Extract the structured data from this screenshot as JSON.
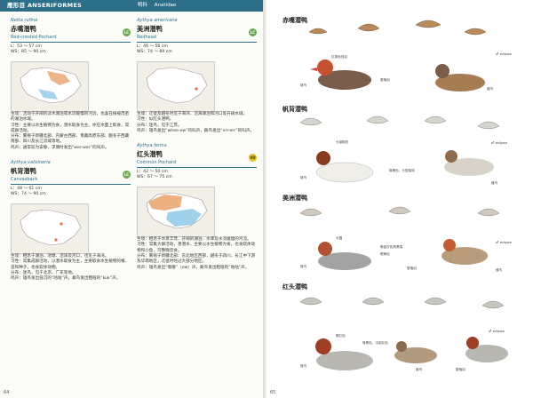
{
  "header": {
    "order": "雁形目 ANSERIFORMES",
    "family_cn": "鸭科",
    "family_en": "Anatidae"
  },
  "species": [
    {
      "sci": "Netta rufina",
      "cn": "赤嘴潜鸭",
      "en": "Red-crested Pochard",
      "status": "LC",
      "L": "L：53 ～ 57 cm",
      "WS": "WS：85 ～ 90 cm",
      "habitat": "生境：活动于开阔的淡水湖泊或水流缓慢的河流，也喜在植被茂密的湖泊水域。",
      "habits": "习性：主要以水生植物为食，潜水取食为主，亦在水面上取食，常成群活动。",
      "dist": "分布：繁殖于新疆北部、内蒙古西部、青藏高原东部，越冬于西藏南部、四川及长江流域等地。",
      "voice": "鸣声：通常较为安静，求偶时发出“wer-wer”的叫声。"
    },
    {
      "sci": "Aythya valisineria",
      "cn": "帆背潜鸭",
      "en": "Canvasback",
      "status": "LC",
      "L": "L：48 ～ 61 cm",
      "WS": "WS：74 ～ 90 cm",
      "habitat": "生境：栖息于湖泊、池塘、沼泽及河口，也见于海湾。",
      "habits": "习性：常集成群活动，以潜水取食为主，主要取食水生植物的根、茎和种子，也食软体动物。",
      "dist": "分布：迷鸟，见于北京、广东等地。",
      "voice": "鸣声：雄鸟发出低沉的“咕咕”声，雌鸟发出粗哑的“kuk”声。"
    },
    {
      "sci": "Aythya americana",
      "cn": "美洲潜鸭",
      "en": "Redhead",
      "status": "LC",
      "L": "L：46 ～ 56 cm",
      "WS": "WS：74 ～ 89 cm",
      "habitat": "生境：迁徙及越冬时见于海湾、沿海湖泊和河口等开阔水域。",
      "habits": "习性：似红头潜鸭。",
      "dist": "分布：迷鸟，见于江苏。",
      "voice": "鸣声：雄鸟发出“whee-ow”的叫声，雌鸟发出“err-err”的叫声。"
    },
    {
      "sci": "Aythya ferina",
      "cn": "红头潜鸭",
      "en": "Common Pochard",
      "status": "VU",
      "L": "L：42 ～ 50 cm",
      "WS": "WS：67 ～ 75 cm",
      "habitat": "生境：栖息于水草丰茂、开阔的湖泊、水库及水流缓慢的河流。",
      "habits": "习性：常集大群活动，善潜水，主要以水生植物为食，也食软体动物和小鱼，可整晚觅食。",
      "dist": "分布：繁殖于新疆北部、东北地区西部，越冬于四川、长江中下游及华南地区，迁徙时经过大部分地区。",
      "voice": "鸣声：雄鸟发出“嗷嗷”（ow）声，雌鸟发出粗哑的“咕咕”声。"
    }
  ],
  "plates": [
    {
      "title": "赤嘴潜鸭",
      "labels": [
        "红铜色冠羽",
        "雄鸟",
        "雌鸟",
        "繁殖羽",
        "雄鸟非繁殖羽似雌鸟",
        "飞行时可见宽阔白色翼带"
      ],
      "eclipse": "♂ eclipse"
    },
    {
      "title": "帆背潜鸭",
      "labels": [
        "雄鸟",
        "头部楔形",
        "雌鸟",
        "喙黑色，头型独特",
        "繁殖羽"
      ],
      "eclipse": "♂ eclipse"
    },
    {
      "title": "美洲潜鸭",
      "labels": [
        "雄鸟",
        "头圆",
        "雌鸟",
        "喙蓝灰色具黑端",
        "眼黄色",
        "繁殖羽"
      ],
      "eclipse": "♂ eclipse"
    },
    {
      "title": "红头潜鸭",
      "labels": [
        "雄鸟",
        "雌鸟",
        "眼红色",
        "喙黑色，中部灰色",
        "繁殖羽"
      ],
      "eclipse": "♂ eclipse"
    }
  ],
  "page_left": "64",
  "page_right": "65",
  "palette": {
    "accent": "#2d6f88",
    "lc": "#6aa84f",
    "vu": "#e3c21a"
  }
}
